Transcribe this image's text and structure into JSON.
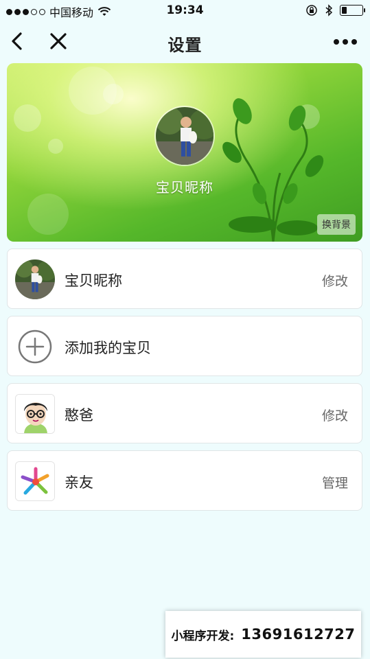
{
  "status_bar": {
    "carrier": "中国移动",
    "time": "19:34",
    "battery_level": 0.25
  },
  "nav": {
    "title": "设置",
    "back_icon": "chevron-left-icon",
    "close_icon": "close-icon",
    "more_icon": "more-dots-icon"
  },
  "banner": {
    "nickname": "宝贝昵称",
    "change_bg_label": "换背景"
  },
  "items": [
    {
      "label": "宝贝昵称",
      "action": "修改",
      "icon": "baby-photo-avatar"
    },
    {
      "label": "添加我的宝贝",
      "action": "",
      "icon": "add-circle-icon"
    },
    {
      "label": "憨爸",
      "action": "修改",
      "icon": "cartoon-dad-avatar"
    },
    {
      "label": "亲友",
      "action": "管理",
      "icon": "colorful-star-icon"
    }
  ],
  "promo": {
    "label": "小程序开发:",
    "phone": "13691612727"
  },
  "colors": {
    "background": "#eefcfd",
    "banner_green": "#7ccc3a",
    "text_primary": "#222222",
    "text_secondary": "#666666"
  }
}
